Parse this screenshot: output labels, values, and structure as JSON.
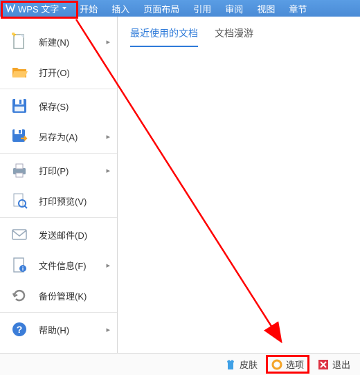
{
  "app": {
    "name": "WPS 文字"
  },
  "menubar": [
    "开始",
    "插入",
    "页面布局",
    "引用",
    "审阅",
    "视图",
    "章节"
  ],
  "sidebar": [
    {
      "id": "new",
      "label": "新建(N)",
      "chev": true
    },
    {
      "id": "open",
      "label": "打开(O)",
      "chev": false,
      "sep_after": true
    },
    {
      "id": "save",
      "label": "保存(S)",
      "chev": false
    },
    {
      "id": "saveas",
      "label": "另存为(A)",
      "chev": true,
      "sep_after": true
    },
    {
      "id": "print",
      "label": "打印(P)",
      "chev": true
    },
    {
      "id": "printprev",
      "label": "打印预览(V)",
      "chev": false,
      "sep_after": true
    },
    {
      "id": "sendmail",
      "label": "发送邮件(D)",
      "chev": false
    },
    {
      "id": "fileinfo",
      "label": "文件信息(F)",
      "chev": true
    },
    {
      "id": "backup",
      "label": "备份管理(K)",
      "chev": false,
      "sep_after": true
    },
    {
      "id": "help",
      "label": "帮助(H)",
      "chev": true
    }
  ],
  "doc_tabs": {
    "recent": "最近使用的文档",
    "roam": "文档漫游"
  },
  "footer": {
    "skin": "皮肤",
    "options": "选项",
    "exit": "退出"
  }
}
